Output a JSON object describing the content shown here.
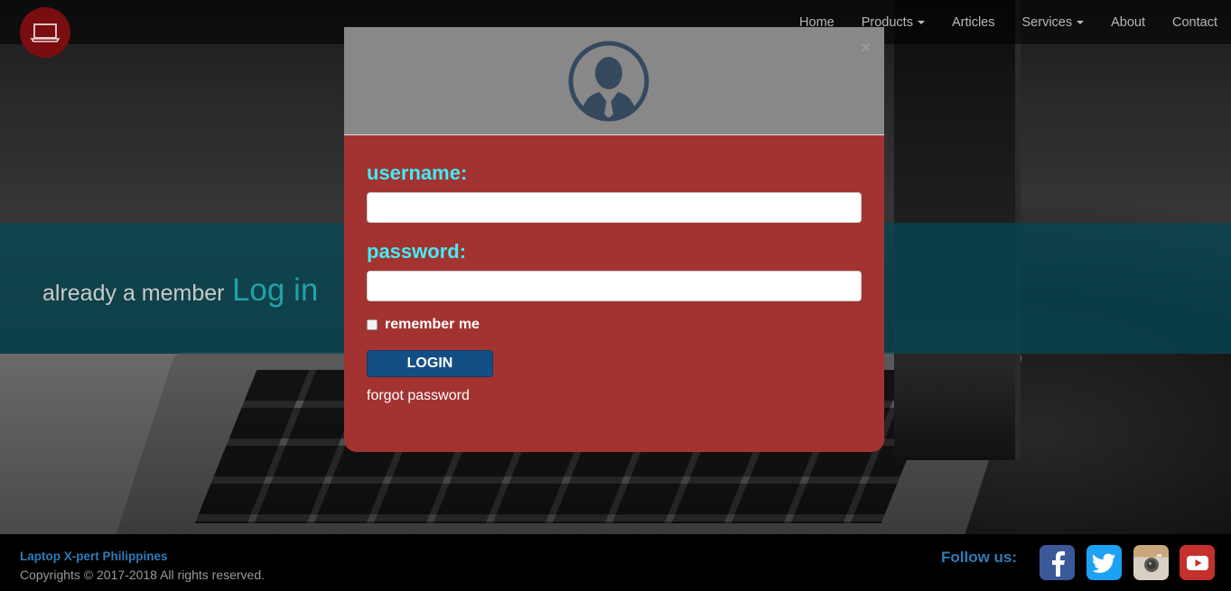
{
  "nav": {
    "items": [
      {
        "label": "Home",
        "dropdown": false
      },
      {
        "label": "Products",
        "dropdown": true
      },
      {
        "label": "Articles",
        "dropdown": false
      },
      {
        "label": "Services",
        "dropdown": true
      },
      {
        "label": "About",
        "dropdown": false
      },
      {
        "label": "Contact",
        "dropdown": false
      }
    ]
  },
  "hero": {
    "cta_text": "already a member",
    "cta_link": "Log in"
  },
  "modal": {
    "close": "×",
    "username_label": "username:",
    "username_value": "",
    "password_label": "password:",
    "password_value": "",
    "remember_label": "remember me",
    "remember_checked": false,
    "login_label": "LOGIN",
    "forgot_label": "forgot password"
  },
  "footer": {
    "brand": "Laptop X-pert Philippines",
    "copyright": "Copyrights © 2017-2018 All rights reserved.",
    "follow": "Follow us:",
    "social": [
      "facebook-icon",
      "twitter-icon",
      "instagram-icon",
      "youtube-icon"
    ]
  },
  "colors": {
    "modal_body": "#a33331",
    "label_cyan": "#41ecf6",
    "login_button": "#134f84",
    "teal_band": "#074652",
    "brand_blue": "#2f7bb7"
  }
}
